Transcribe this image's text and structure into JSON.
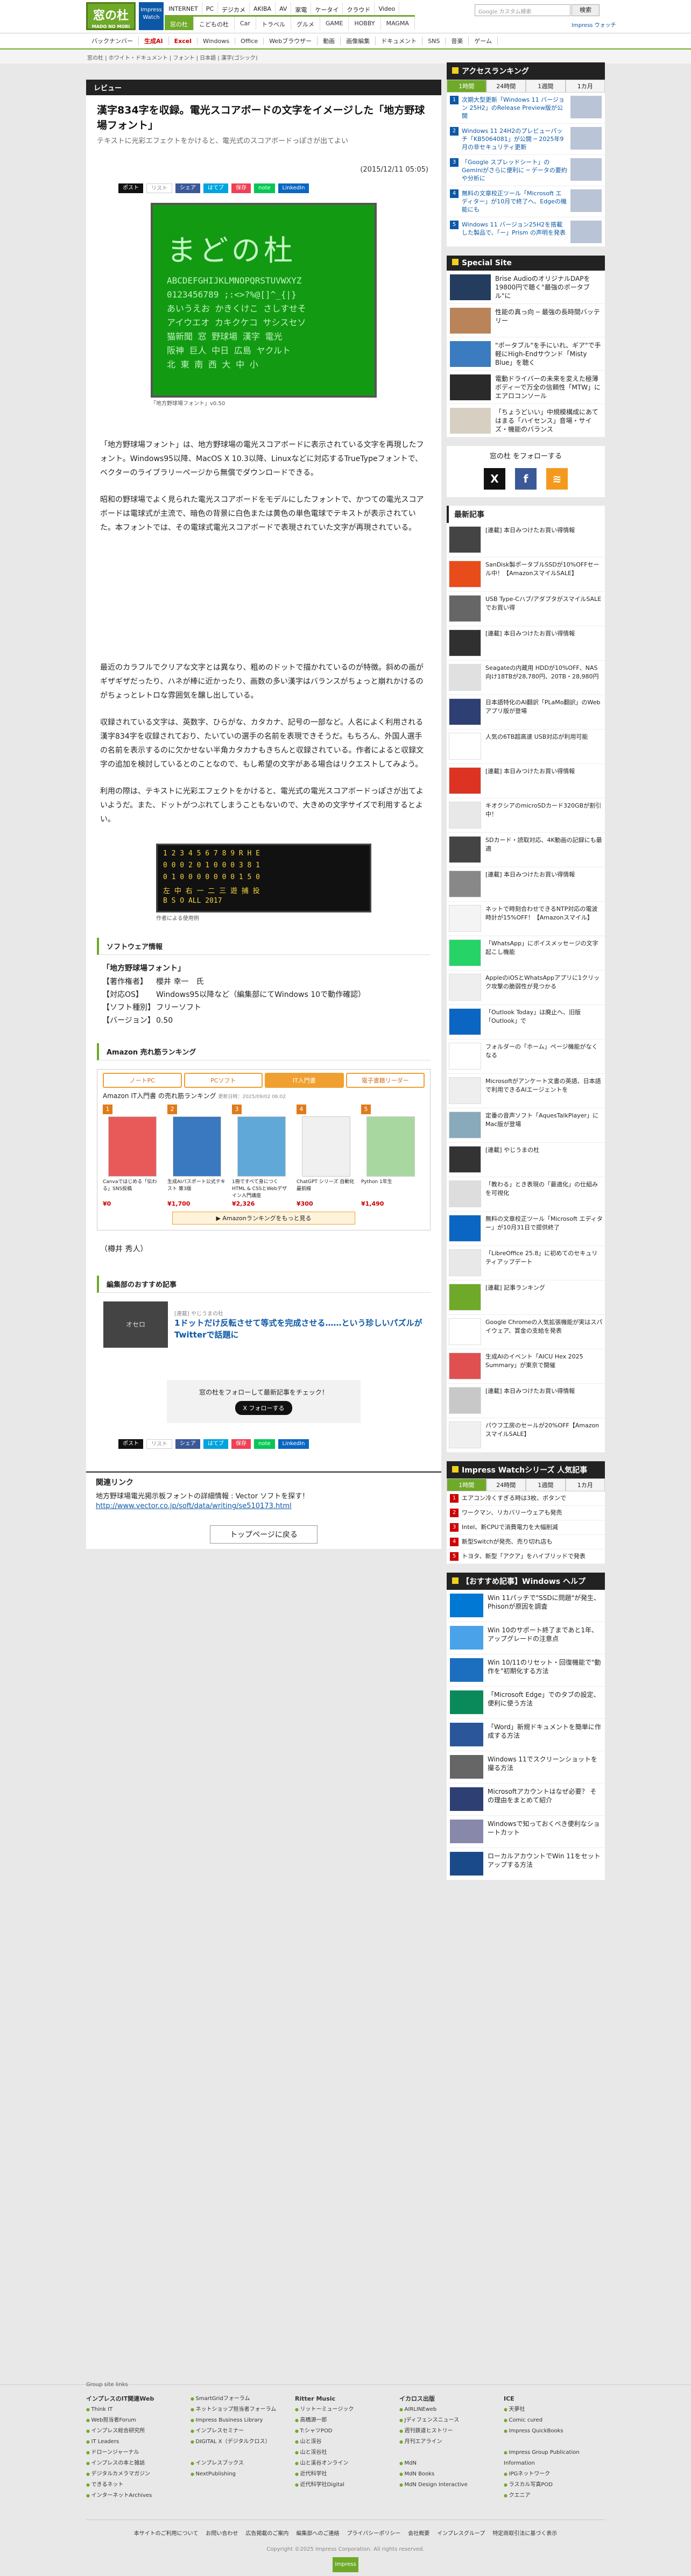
{
  "header": {
    "logo": "窓の杜",
    "logo_sub": "MADO NO MORI",
    "impress": "Impress Watch",
    "site_tabs": [
      "INTERNET",
      "PC",
      "デジカメ",
      "AKIBA",
      "AV",
      "家電",
      "ケータイ",
      "クラウド",
      "Video"
    ],
    "sub_tabs": [
      "窓の杜",
      "こどもの杜",
      "Car",
      "トラベル",
      "グルメ",
      "GAME",
      "HOBBY",
      "MAGMA"
    ],
    "search_placeholder": "Google カスタム検索",
    "search_button": "検索",
    "impress_link": "Impress ウォッチ"
  },
  "genre_bar": [
    "バックナンバー",
    "生成AI",
    "Excel",
    "Windows",
    "Office",
    "Webブラウザー",
    "動画",
    "画像編集",
    "ドキュメント",
    "SNS",
    "音楽",
    "ゲーム"
  ],
  "breadcrumb": "窓の杜 | ホワイト・ドキュメント | フォント | 日本語 | 漢字(ゴシック)",
  "article": {
    "category": "レビュー",
    "title": "漢字834字を収録。電光スコアボードの文字をイメージした「地方野球場フォント」",
    "subtitle": "テキストに光彩エフェクトをかけると、電光式のスコアボードっぽさが出てよい",
    "date": "(2015/12/11 05:05)",
    "share": {
      "x": "ポスト",
      "x_count": "リスト",
      "fb": "シェア",
      "hb": "はてブ",
      "pocket": "保存",
      "line": "note",
      "li": "LinkedIn"
    },
    "shot1_big": "まどの杜",
    "shot1_lines": [
      "ABCDEFGHIJKLMNOPQRSTUVWXYZ",
      "0123456789 ;:<>?%@[]^_{|}",
      "あいうえお かきくけこ さしすせそ",
      "アイウエオ カキクケコ サシスセソ",
      "猫新聞 窓 野球場 漢字 電光",
      "阪神 巨人 中日 広島 ヤクルト",
      "北 東 南 西 大 中 小"
    ],
    "cap1": "「地方野球場フォント」v0.50",
    "p1": "「地方野球場フォント」は、地方野球場の電光スコアボードに表示されている文字を再現したフォント。Windows95以降、MacOS X 10.3以降、Linuxなどに対応するTrueTypeフォントで、ベクターのライブラリーページから無償でダウンロードできる。",
    "p2": "昭和の野球場でよく見られた電光スコアボードをモデルにしたフォントで、かつての電光スコアボードは電球式が主流で、暗色の背景に白色または黄色の単色電球でテキストが表示されていた。本フォントでは、その電球式電光スコアボードで表現されていた文字が再現されている。",
    "p3": "最近のカラフルでクリアな文字とは異なり、粗めのドットで描かれているのが特徴。斜めの画がギザギザだったり、ハネが棒に近かったり、画数の多い漢字はバランスがちょっと崩れかけるのがちょっとレトロな雰囲気を醸し出している。",
    "p4": "収録されている文字は、英数字、ひらがな、カタカナ、記号の一部など。人名によく利用される漢字834字を収録されており、たいていの選手の名前を表現できそうだ。もちろん、外国人選手の名前を表示するのに欠かせない半角カタカナもきちんと収録されている。作者によると収録文字の追加を検討しているとのことなので、もし希望の文字がある場合はリクエストしてみよう。",
    "p5": "利用の際は、テキストに光彩エフェクトをかけると、電光式の電光スコアボードっぽさが出てよいようだ。また、ドットがつぶれてしまうこともないので、大きめの文字サイズで利用するとよい。",
    "shot2_rows": [
      "1 2 3 4 5 6 7 8 9 R H E",
      "0 0 0 2 0 1 0 0 0 3 8 1",
      "0 1 0 0 0 0 0 0 0 1 5 0",
      "左 中 右 一 二 三 遊 捕 投",
      "B S O  ALL 2017"
    ],
    "cap2": "作者による使用例",
    "software_head": "ソフトウェア情報",
    "software_name": "「地方野球場フォント」",
    "software_rows": [
      {
        "k": "【著作権者】",
        "v": "櫻井 幸一　氏"
      },
      {
        "k": "【対応OS】",
        "v": "Windows95以降など（編集部にてWindows 10で動作確認）"
      },
      {
        "k": "【ソフト種別】",
        "v": "フリーソフト"
      },
      {
        "k": "【バージョン】",
        "v": "0.50"
      }
    ],
    "amazon_head": "Amazon 売れ筋ランキング",
    "amazon_tabs": [
      "ノートPC",
      "PCソフト",
      "IT入門書",
      "電子書籍リーダー"
    ],
    "amazon_title": "Amazon IT入門書 の売れ筋ランキング",
    "amazon_updated": "更新日時：2025/09/02 06:02",
    "amazon_items": [
      {
        "n": "1",
        "t": "Canvaではじめる「伝わる」SNS投稿",
        "p": "¥0",
        "c": "#e85a5a"
      },
      {
        "n": "2",
        "t": "生成AIパスポート公式テキスト 第3版",
        "p": "¥1,700",
        "c": "#3a78c0"
      },
      {
        "n": "3",
        "t": "1冊ですべて身につくHTML & CSSとWebデザイン入門講座",
        "p": "¥2,326",
        "c": "#60a8d8"
      },
      {
        "n": "4",
        "t": "ChatGPT シリーズ 自動化最前線",
        "p": "¥300",
        "c": "#f0f0f0"
      },
      {
        "n": "5",
        "t": "Python 1年生",
        "p": "¥1,490",
        "c": "#a8d8a0"
      }
    ],
    "amazon_more": "▶ Amazonランキングをもっと見る",
    "byline": "（樽井 秀人）",
    "rec_head": "編集部のおすすめ記事",
    "rec_img": "オセロ",
    "rec_tag": "[連載] やじうまの杜",
    "rec_title": "1ドットだけ反転させて等式を完成させる……という珍しいパズルがTwitterで話題に",
    "follow_text": "窓の杜をフォローして最新記事をチェック！",
    "follow_x": "X フォローする",
    "related_head": "関連リンク",
    "related_text": "地方野球場電光掲示板フォントの詳細情報 : Vector ソフトを探す！",
    "related_url": "http://www.vector.co.jp/soft/data/writing/se510173.html",
    "top_btn": "トップページに戻る"
  },
  "sidebar": {
    "ranking_head": "アクセスランキング",
    "ranking_tabs": [
      "1時間",
      "24時間",
      "1週間",
      "1カ月"
    ],
    "ranking_items": [
      "次期大型更新「Windows 11 バージョン 25H2」のRelease Preview版が公開",
      "Windows 11 24H2のプレビューパッチ「KB5064081」が公開 ─ 2025年9月の非セキュリティ更新",
      "「Google スプレッドシート」のGeminiがさらに便利に ─ データの要約や分析に",
      "無料の文章校正ツール「Microsoft エディター」が10月で終了へ、Edgeの機能にも",
      "Windows 11 バージョン25H2を搭載した製品で、「ー」Prism の声明を発表"
    ],
    "special_head": "Special Site",
    "special_items": [
      {
        "t": "Brise AudioのオリジナルDAPを19800円で聴く\"最強のポータブル\"に",
        "c": "#243c5e"
      },
      {
        "t": "性能の真っ向 ─ 最強の長時間バッテリー",
        "c": "#b9845a"
      },
      {
        "t": "\"ポータブル\"を手にいれ、ギア\"で手軽にHigh-Endサウンド「Misty Blue」を聴く",
        "c": "#3b7bbf"
      },
      {
        "t": "電動ドライバーの未来を変えた極薄ボディーで万全の信頼性「MTW」にエアロコンソール",
        "c": "#2a2a2a"
      },
      {
        "t": "「ちょうどいい」中規模構成にあてはまる「ハイセンス」音場・サイズ・機能のバランス",
        "c": "#d7d0c2"
      }
    ],
    "follow_head": "窓の杜 をフォローする",
    "news_head": "最新記事",
    "news_items": [
      {
        "t": "[連載] 本日みつけたお買い得情報",
        "c": "#444"
      },
      {
        "t": "SanDisk製ポータブルSSDが10%OFFセール中！【AmazonスマイルSALE】",
        "c": "#e84c1a"
      },
      {
        "t": "USB Type-Cハブ/アダプタがスマイルSALEでお買い得",
        "c": "#666"
      },
      {
        "t": "[連載] 本日みつけたお買い得情報",
        "c": "#303030"
      },
      {
        "t": "Seagateの内蔵用 HDDが10%OFF、NAS向け18TBが28,780円、20TB・28,980円",
        "c": "#e0e0e0"
      },
      {
        "t": "日本語特化のAI翻訳「PLaMo翻訳」のWebアプリ版が登場",
        "c": "#2e3f74"
      },
      {
        "t": "人気の6TB超高速 USB対応が利用可能",
        "c": "#fff"
      },
      {
        "t": "[連載] 本日みつけたお買い得情報",
        "c": "#d32"
      },
      {
        "t": "キオクシアのmicroSDカード320GBが割引中！",
        "c": "#e8e8e8"
      },
      {
        "t": "SDカード・読取対応、4K動画の記録にも最適",
        "c": "#444"
      },
      {
        "t": "[連載] 本日みつけたお買い得情報",
        "c": "#888"
      },
      {
        "t": "ネットで時刻合わせできるNTP対応の電波時計が15%OFF！【Amazonスマイル】",
        "c": "#f4f4f4"
      },
      {
        "t": "「WhatsApp」にボイスメッセージの文字起こし機能",
        "c": "#25d366"
      },
      {
        "t": "AppleのiOSとWhatsAppアプリに1クリック攻撃の脆弱性が見つかる",
        "c": "#eee"
      },
      {
        "t": "「Outlook Today」は廃止へ、旧版「Outlook」で",
        "c": "#0a66c2"
      },
      {
        "t": "フォルダーの「ホーム」ページ機能がなくなる",
        "c": "#fff"
      },
      {
        "t": "Microsoftがアンケート文書の英語、日本語で利用できるAIエージェントを",
        "c": "#eee"
      },
      {
        "t": "定番の音声ソフト「AquesTalkPlayer」に Mac版が登場",
        "c": "#8ab"
      },
      {
        "t": "[連載] やじうまの杜",
        "c": "#333"
      },
      {
        "t": "「教わる」とき表現の「最適化」の仕組みを可視化",
        "c": "#ddd"
      },
      {
        "t": "無料の文章校正ツール「Microsoft エディター」が10月31日で提供終了",
        "c": "#0a66c2"
      },
      {
        "t": "「LibreOffice 25.8」に初めてのセキュリティアップデート",
        "c": "#e8e8e8"
      },
      {
        "t": "[連載] 記事ランキング",
        "c": "#6fa92a"
      },
      {
        "t": "Google Chromeの人気拡張機能が実はスパイウェア、賞金の支給を発表",
        "c": "#fff"
      },
      {
        "t": "生成AIのイベント「AICU Hex 2025 Summary」が東京で開催",
        "c": "#e05050"
      },
      {
        "t": "[連載] 本日みつけたお買い得情報",
        "c": "#c8c8c8"
      },
      {
        "t": "パウフ工房のセールが20%OFF【AmazonスマイルSALE】",
        "c": "#f0f0f0"
      }
    ],
    "iw_head": "Impress Watchシリーズ 人気記事",
    "iw_tabs": [
      "1時間",
      "24時間",
      "1週間",
      "1カ月"
    ],
    "iw_items": [
      "エアコン冷くすぎる時は3枚、ボタンで",
      "ワークマン、リカバリーウェアも発売",
      "Intel、新CPUで消費電力を大幅削減",
      "新型Switchが発売、売り切れ店も",
      "トヨタ、新型「アクア」をハイブリッドで発表"
    ],
    "win_head": "【おすすめ記事】Windows ヘルプ",
    "win_items": [
      {
        "t": "Win 11パッチで\"SSDに問題\"が発生、Phisonが原因を調査",
        "c": "#0078d4"
      },
      {
        "t": "Win 10のサポート終了まであと1年、アップグレードの注意点",
        "c": "#4aa3e8"
      },
      {
        "t": "Win 10/11のリセット・回復機能で\"動作を\"初期化する方法",
        "c": "#1c6fbf"
      },
      {
        "t": "「Microsoft Edge」でのタブの設定、便利に使う方法",
        "c": "#0a8a5a"
      },
      {
        "t": "「Word」新規ドキュメントを簡単に作成する方法",
        "c": "#2b579a"
      },
      {
        "t": "Windows 11でスクリーンショットを撮る方法",
        "c": "#666"
      },
      {
        "t": "Microsoftアカウントはなぜ必要？ その理由をまとめて紹介",
        "c": "#2e3f74"
      },
      {
        "t": "Windowsで知っておくべき便利なショートカット",
        "c": "#88a"
      },
      {
        "t": "ローカルアカウントでWin 11をセットアップする方法",
        "c": "#1a4a8a"
      }
    ]
  },
  "footer": {
    "group_label": "Group site links",
    "columns": [
      {
        "h": "インプレスのIT関連Web",
        "items": [
          "Think IT",
          "Web担当者Forum",
          "インプレス総合研究所",
          "IT Leaders",
          "ドローンジャーナル",
          "インプレスの本と雑誌",
          "デジタルカメラマガジン",
          "できるネット",
          "インターネットArchives"
        ]
      },
      {
        "h": "",
        "items": [
          "SmartGridフォーラム",
          "ネットショップ担当者フォーラム",
          "Impress Business Library",
          "インプレスセミナー",
          "DIGITAL X（デジタルクロス）",
          "",
          "インプレスブックス",
          "NextPublishing"
        ]
      },
      {
        "h": "Ritter Music",
        "items": [
          "リットーミュージック",
          "高橋源一郎",
          "T:シャツPOD",
          "山と渓谷",
          "山と渓谷社",
          "山と溪谷オンライン",
          "近代科学社",
          "近代科学社Digital"
        ]
      },
      {
        "h": "イカロス出版",
        "items": [
          "AIRLINEweb",
          "Jディフェンスニュース",
          "週刊鉄道ヒストリー",
          "月刊エアライン",
          "",
          "MdN",
          "MdN Books",
          "MdN Design Interactive"
        ]
      },
      {
        "h": "ICE",
        "items": [
          "天夢社",
          "Comic cured",
          "Impress QuickBooks",
          "",
          "Impress Group Publication Information",
          "IPGネットワーク",
          "ラスカル写真POD",
          "クエニア"
        ]
      }
    ],
    "links": [
      "本サイトのご利用について",
      "お問い合わせ",
      "広告掲載のご案内",
      "編集部へのご連絡",
      "プライバシーポリシー",
      "会社概要",
      "インプレスグループ",
      "特定商取引法に基づく表示"
    ],
    "copyright": "Copyright ©2025 Impress Corporation. All rights reserved.",
    "bottom_logo": "impress"
  }
}
